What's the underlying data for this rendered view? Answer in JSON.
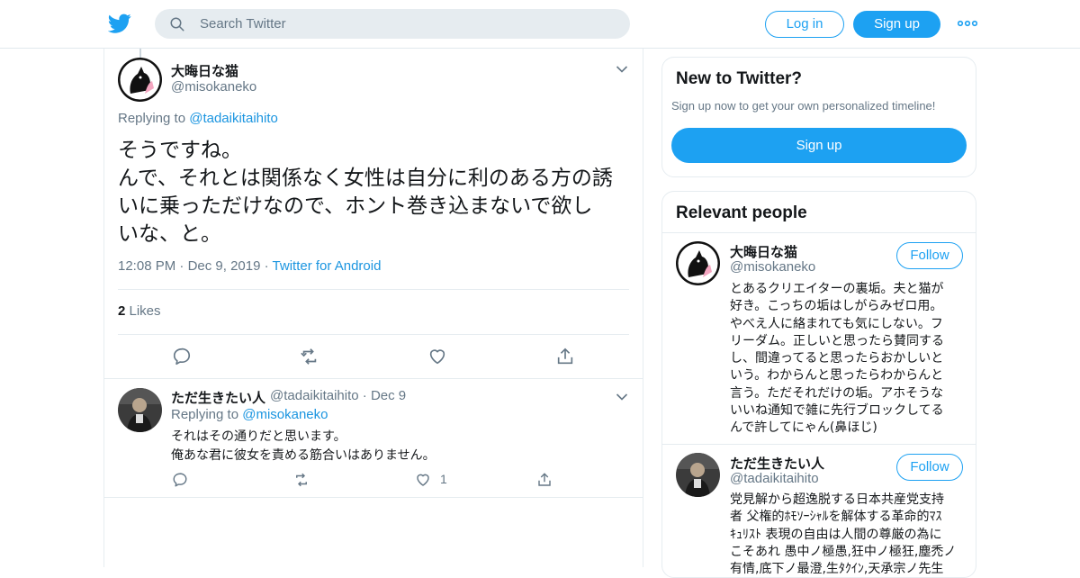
{
  "header": {
    "search_placeholder": "Search Twitter",
    "login_label": "Log in",
    "signup_label": "Sign up",
    "icons": [
      "twitter-bird-icon",
      "search-icon",
      "more-icon"
    ],
    "accent": "#1da1f2"
  },
  "tweet": {
    "author_name": "大晦日な猫",
    "author_handle": "@misokaneko",
    "replying_prefix": "Replying to ",
    "replying_handle": "@tadaikitaihito",
    "text_lines": [
      "そうですね。",
      "んで、それとは関係なく女性は自分に利のある方の誘",
      "いに乗っただけなので、ホント巻き込まないで欲し",
      "いな、と。"
    ],
    "time": "12:08 PM",
    "date": "Dec 9, 2019",
    "source": "Twitter for Android",
    "likes_count": "2",
    "likes_label": " Likes"
  },
  "reply": {
    "author_name": "ただ生きたい人",
    "author_handle": "@tadaikitaihito",
    "date": "Dec 9",
    "replying_prefix": "Replying to ",
    "replying_handle": "@misokaneko",
    "text_lines": [
      "それはその通りだと思います。",
      "俺あな君に彼女を責める筋合いはありません。"
    ],
    "like_count": "1"
  },
  "new_to_twitter": {
    "title": "New to Twitter?",
    "subtitle": "Sign up now to get your own personalized timeline!",
    "signup_label": "Sign up"
  },
  "relevant_people": {
    "title": "Relevant people",
    "people": [
      {
        "name": "大晦日な猫",
        "handle": "@misokaneko",
        "follow_label": "Follow",
        "bio_lines": [
          "とあるクリエイターの裏垢。夫と猫が",
          "好き。こっちの垢はしがらみゼロ用。",
          "やべえ人に絡まれても気にしない。フ",
          "リーダム。正しいと思ったら賛同する",
          "し、間違ってると思ったらおかしいと",
          "いう。わからんと思ったらわからんと",
          "言う。ただそれだけの垢。アホそうな",
          "いいね通知で雑に先行ブロックしてる",
          "んで許してにゃん(鼻ほじ)"
        ]
      },
      {
        "name": "ただ生きたい人",
        "handle": "@tadaikitaihito",
        "follow_label": "Follow",
        "bio_lines": [
          "党見解から超逸脱する日本共産党支持",
          "者 父権的ﾎﾓｿｰｼｬﾙを解体する革命的ﾏｽ",
          "ｷｭﾘｽﾄ 表現の自由は人間の尊厳の為に",
          "こそあれ 愚中ノ極愚,狂中ノ極狂,塵禿ノ",
          "有情,底下ノ最澄,生ﾀｸｲﾝ,天承宗ノ先生"
        ]
      }
    ]
  }
}
